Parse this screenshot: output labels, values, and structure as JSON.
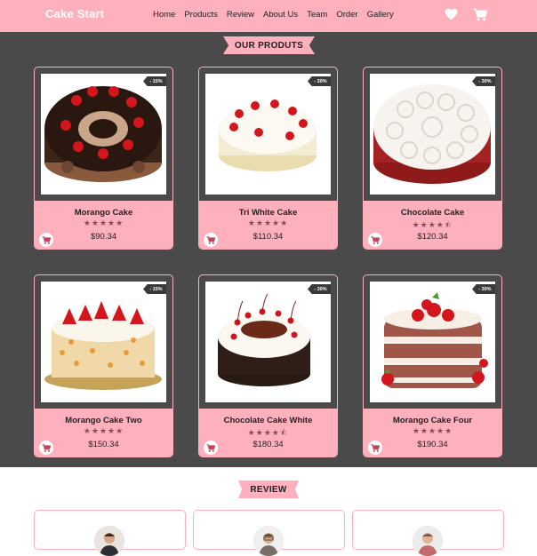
{
  "navbar": {
    "brand": "Cake Start",
    "links": [
      "Home",
      "Products",
      "Review",
      "About Us",
      "Team",
      "Order",
      "Gallery"
    ],
    "icons": [
      "heart-icon",
      "cart-icon"
    ]
  },
  "products_section": {
    "title": "OUR PRODUTS",
    "items": [
      {
        "name": "Morango Cake",
        "price": "$90.34",
        "discount": "- 15%",
        "rating": 5,
        "stars": "★★★★★"
      },
      {
        "name": "Tri White Cake",
        "price": "$110.34",
        "discount": "- 30%",
        "rating": 5,
        "stars": "★★★★★"
      },
      {
        "name": "Chocolate Cake",
        "price": "$120.34",
        "discount": "- 30%",
        "rating": 4.5,
        "stars": "★★★★⯪"
      },
      {
        "name": "Morango Cake Two",
        "price": "$150.34",
        "discount": "- 15%",
        "rating": 5,
        "stars": "★★★★★"
      },
      {
        "name": "Chocolate Cake White",
        "price": "$180.34",
        "discount": "- 30%",
        "rating": 4.5,
        "stars": "★★★★⯪"
      },
      {
        "name": "Morango Cake Four",
        "price": "$190.34",
        "discount": "- 30%",
        "rating": 5,
        "stars": "★★★★★"
      }
    ]
  },
  "review_section": {
    "title": "REVIEW"
  },
  "colors": {
    "accent": "#ffb0bd",
    "dark_bg": "#4a4a4a",
    "star": "#8a4b55"
  }
}
